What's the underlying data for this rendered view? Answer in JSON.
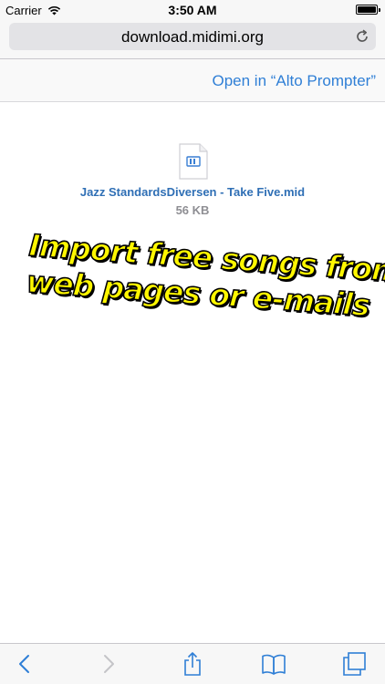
{
  "status_bar": {
    "carrier": "Carrier",
    "time": "3:50 AM"
  },
  "browser": {
    "url": "download.midimi.org",
    "open_in_label": "Open in “Alto Prompter”"
  },
  "file": {
    "name": "Jazz StandardsDiversen - Take Five.mid",
    "size": "56 KB"
  },
  "promo": {
    "line1": "Import free songs from",
    "line2": "web pages or e-mails"
  },
  "colors": {
    "link_blue": "#2f7fd6",
    "promo_yellow": "#fff700",
    "tint": "#2f7fd6"
  },
  "icons": {
    "status": [
      "wifi-icon",
      "battery-icon"
    ],
    "url_bar": [
      "reload-icon"
    ],
    "file": "midi-file-icon",
    "toolbar": [
      "back-icon",
      "forward-icon",
      "share-icon",
      "bookmarks-icon",
      "tabs-icon"
    ]
  }
}
